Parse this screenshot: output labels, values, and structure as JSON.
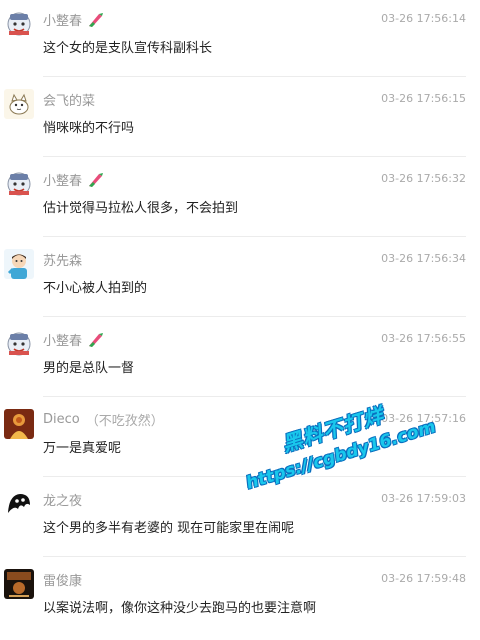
{
  "messages": [
    {
      "name": "小整春",
      "note": "",
      "time": "03-26 17:56:14",
      "text": "这个女的是支队宣传科副科长",
      "avatar": "snowman-avatar",
      "badge": true
    },
    {
      "name": "会飞的菜",
      "note": "",
      "time": "03-26 17:56:15",
      "text": "悄咪咪的不行吗",
      "avatar": "cat-avatar",
      "badge": false
    },
    {
      "name": "小整春",
      "note": "",
      "time": "03-26 17:56:32",
      "text": "估计觉得马拉松人很多，不会拍到",
      "avatar": "snowman-avatar",
      "badge": true
    },
    {
      "name": "苏先森",
      "note": "",
      "time": "03-26 17:56:34",
      "text": "不小心被人拍到的",
      "avatar": "boy-avatar",
      "badge": false
    },
    {
      "name": "小整春",
      "note": "",
      "time": "03-26 17:56:55",
      "text": "男的是总队一督",
      "avatar": "snowman-avatar",
      "badge": true
    },
    {
      "name": "Dieco",
      "note": "（不吃孜然）",
      "time": "03-26 17:57:16",
      "text": "万一是真爱呢",
      "avatar": "figure-avatar",
      "badge": false
    },
    {
      "name": "龙之夜",
      "note": "",
      "time": "03-26 17:59:03",
      "text": "这个男的多半有老婆的 现在可能家里在闹呢",
      "avatar": "ghost-avatar",
      "badge": false
    },
    {
      "name": "雷俊康",
      "note": "",
      "time": "03-26 17:59:48",
      "text": "以案说法啊，像你这种没少去跑马的也要注意啊",
      "avatar": "poster-avatar",
      "badge": false
    }
  ],
  "watermark": {
    "line1": "黑料不打烊",
    "line2": "https://cgbdy16.com"
  },
  "badge_icon": "feather-pen-icon",
  "colors": {
    "name": "#999999",
    "time": "#aaaaaa",
    "text": "#222222",
    "divider": "#ececec",
    "watermark": "#19c7ec"
  }
}
